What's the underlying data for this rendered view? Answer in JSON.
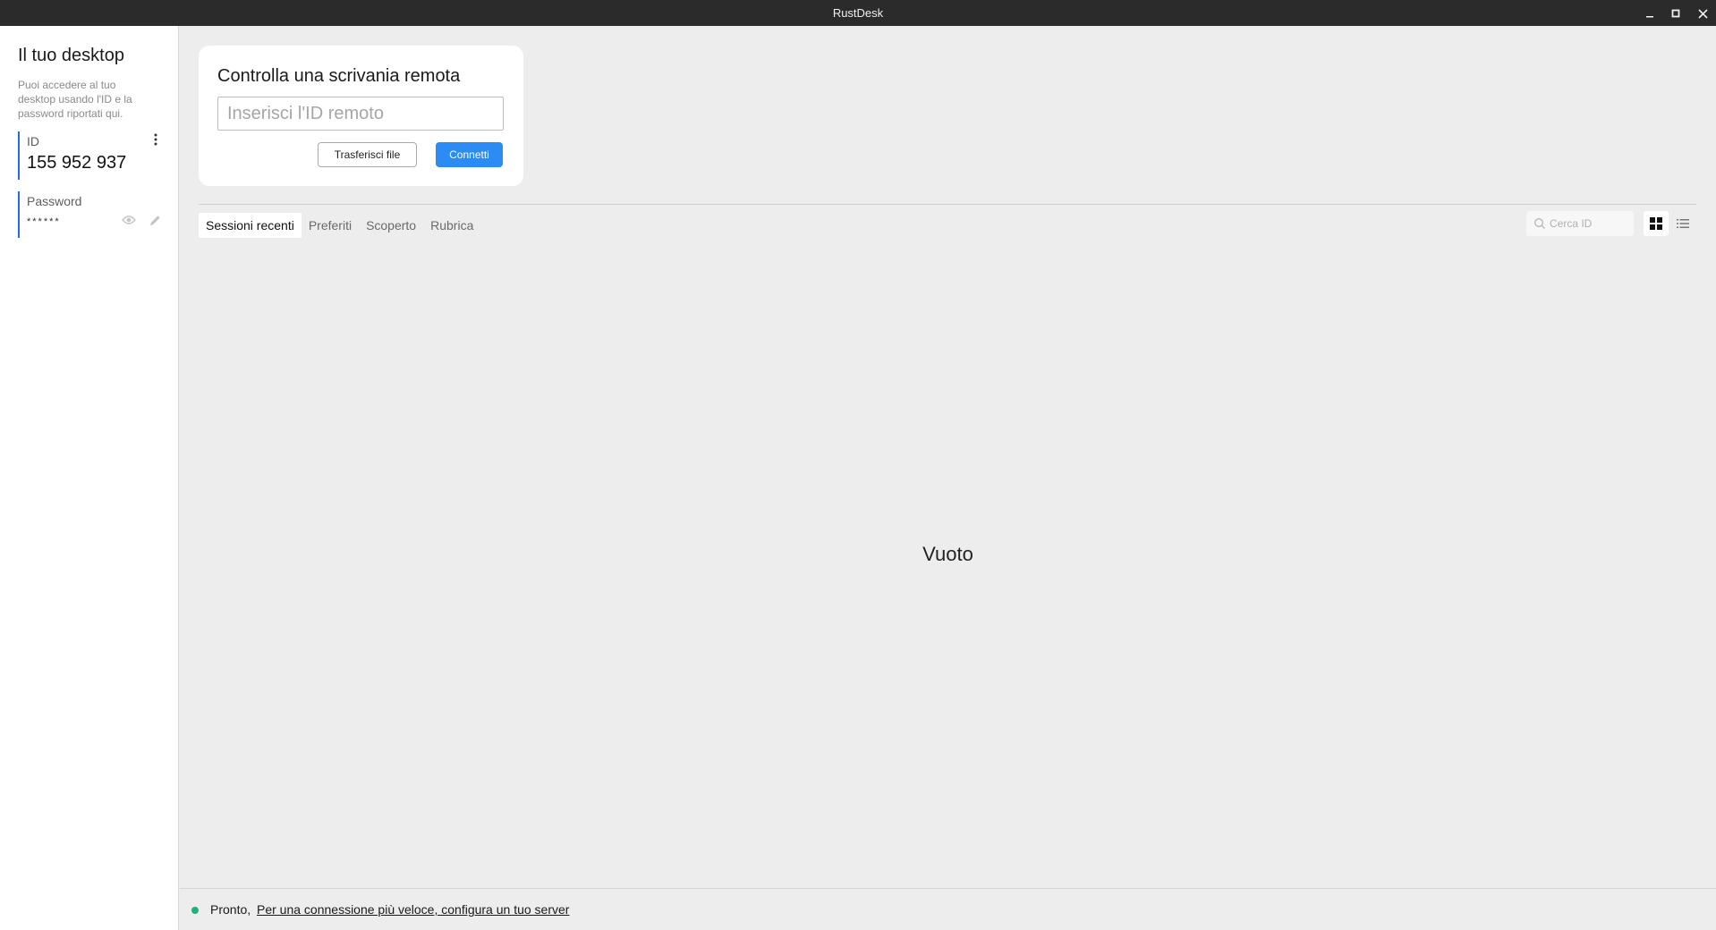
{
  "window": {
    "title": "RustDesk"
  },
  "sidebar": {
    "title": "Il tuo desktop",
    "description": "Puoi accedere al tuo desktop usando l'ID e la password riportati qui.",
    "id_label": "ID",
    "id_value": "155 952 937",
    "password_label": "Password",
    "password_value": "******"
  },
  "connect": {
    "title": "Controlla una scrivania remota",
    "input_placeholder": "Inserisci l'ID remoto",
    "transfer_label": "Trasferisci file",
    "connect_label": "Connetti"
  },
  "tabs": [
    {
      "label": "Sessioni recenti",
      "active": true
    },
    {
      "label": "Preferiti",
      "active": false
    },
    {
      "label": "Scoperto",
      "active": false
    },
    {
      "label": "Rubrica",
      "active": false
    }
  ],
  "search": {
    "placeholder": "Cerca ID"
  },
  "content": {
    "empty_text": "Vuoto"
  },
  "status": {
    "text": "Pronto,",
    "link": "Per una connessione più veloce, configura un tuo server",
    "dot_color": "#22b07d"
  },
  "colors": {
    "accent": "#2c8cf4",
    "sidebar_accent": "#1f6fe0"
  }
}
